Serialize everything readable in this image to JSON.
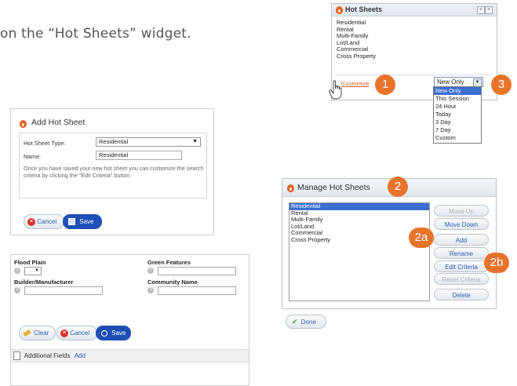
{
  "instruction_text": "on the “Hot Sheets” widget.",
  "hot_sheets_widget": {
    "title": "Hot Sheets",
    "items": [
      "Residential",
      "Rental",
      "Multi-Family",
      "Lot/Land",
      "Commercial",
      "Cross Property"
    ],
    "customize_link": "Customize",
    "select_value": "New Only",
    "dropdown_options": [
      "New Only",
      "This Session",
      "24 Hour",
      "Today",
      "3 Day",
      "7 Day",
      "Custom"
    ],
    "selected_option_index": 0
  },
  "callouts": {
    "c1": "1",
    "c2": "2",
    "c2a": "2a",
    "c2b": "2b",
    "c3": "3"
  },
  "add_hot_sheet": {
    "title": "Add Hot Sheet",
    "type_label": "Hot Sheet Type:",
    "type_value": "Residential",
    "name_label": "Name:",
    "name_value": "Residential",
    "help_text": "Once you have saved your new hot sheet you can customize the search criteria by clicking the \"Edit Criteria\" button.",
    "cancel_label": "Cancel",
    "save_label": "Save"
  },
  "search_form": {
    "flood_plain_label": "Flood Plain",
    "green_features_label": "Green Features",
    "builder_label": "Builder/Manufacturer",
    "community_label": "Community Name",
    "clear_label": "Clear",
    "cancel_label": "Cancel",
    "save_label": "Save",
    "additional_fields_label": "Additional Fields",
    "add_link": "Add"
  },
  "manage_hot_sheets": {
    "title": "Manage Hot Sheets",
    "items": [
      "Residential",
      "Rental",
      "Multi-Family",
      "Lot/Land",
      "Commercial",
      "Cross Property"
    ],
    "selected_index": 0,
    "move_up": "Move Up",
    "move_down": "Move Down",
    "add": "Add",
    "rename": "Rename",
    "edit_criteria": "Edit Criteria",
    "reset_criteria": "Reset Criteria",
    "delete": "Delete"
  },
  "done_label": "Done",
  "colors": {
    "accent_orange": "#e8742c",
    "link_blue": "#2a5db0",
    "selection_blue": "#3d6fd1"
  }
}
